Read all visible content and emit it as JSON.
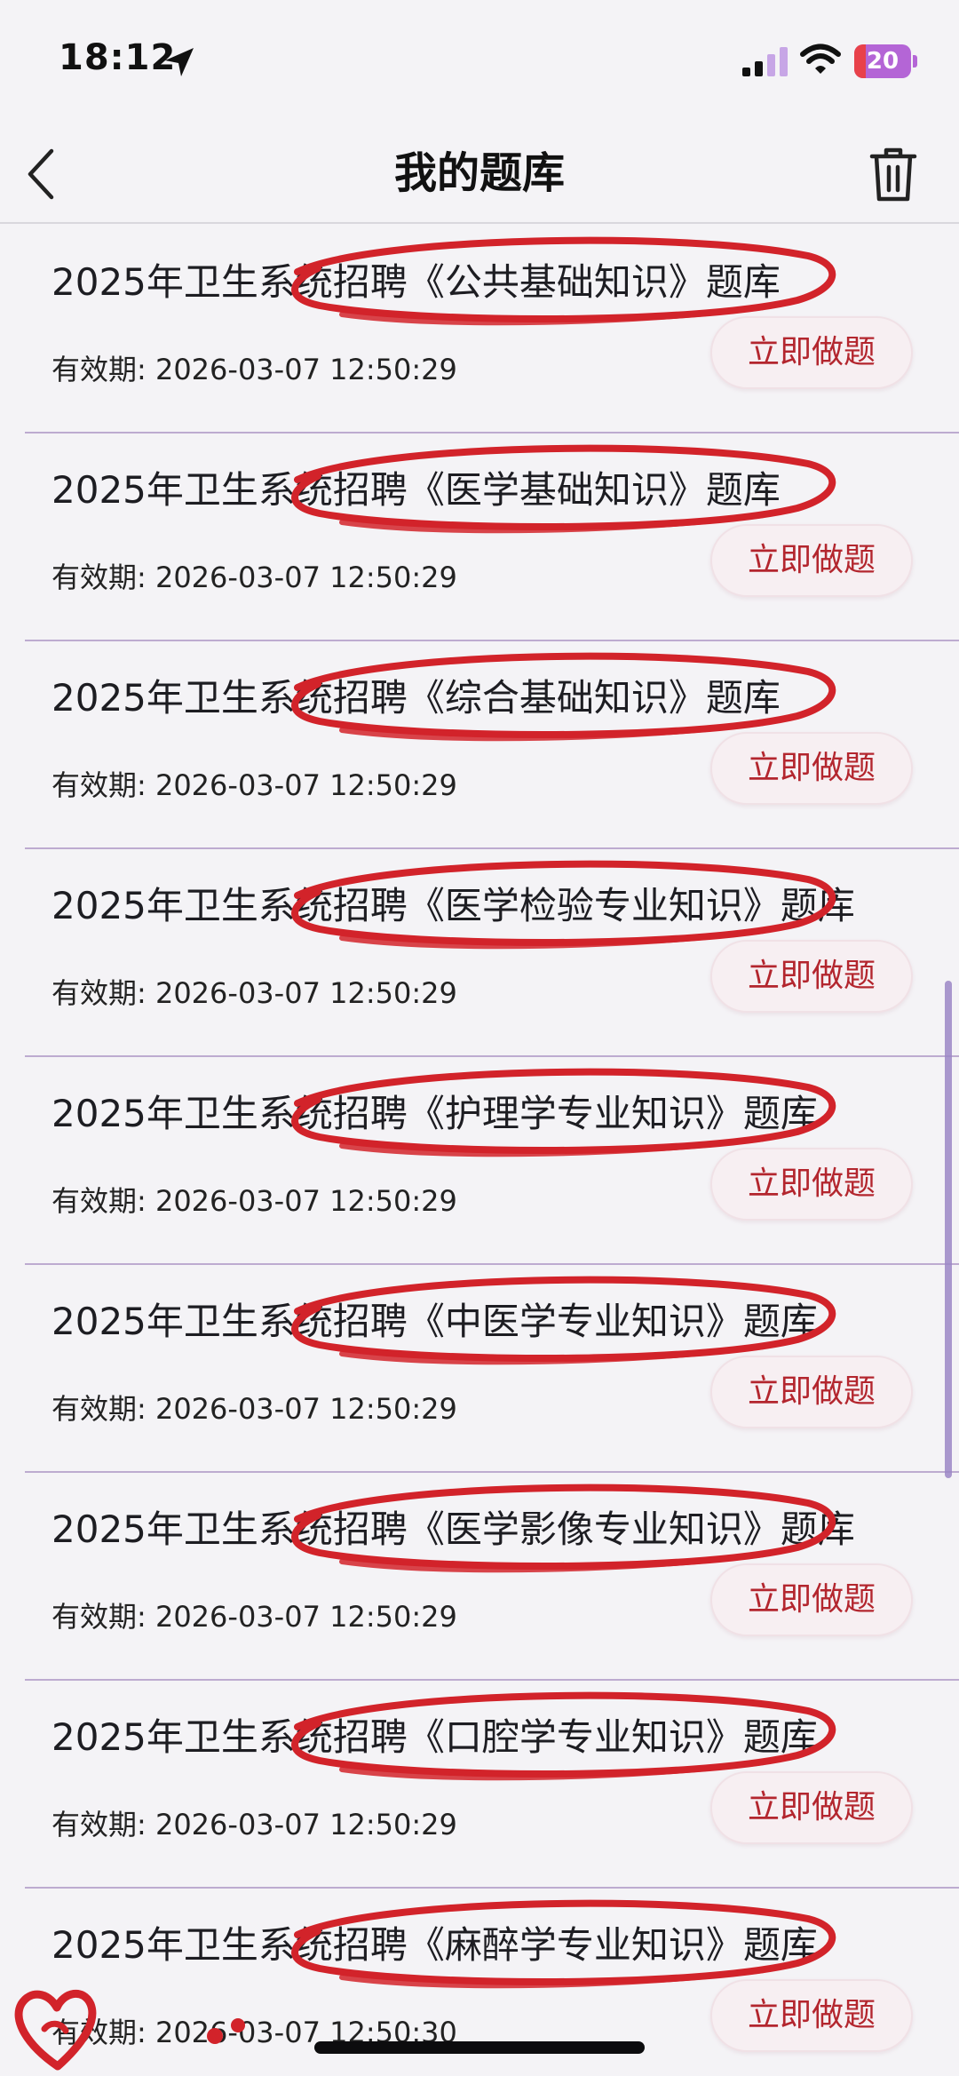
{
  "status_bar": {
    "time": "18:12",
    "battery": "20",
    "battery_level": 0.2,
    "icons": [
      "location-arrow-icon",
      "cellular-signal-icon",
      "wifi-icon",
      "battery-icon"
    ]
  },
  "nav": {
    "title": "我的题库",
    "back_icon": "chevron-left-icon",
    "delete_icon": "trash-icon"
  },
  "colors": {
    "accent": "#b3262e",
    "annotation": "#d2232a",
    "divider": "#8f6fb0",
    "background": "#f4f3f6"
  },
  "items": [
    {
      "title": "2025年卫生系统招聘《公共基础知识》题库",
      "expiry": "有效期: 2026-03-07 12:50:29",
      "action": "立即做题"
    },
    {
      "title": "2025年卫生系统招聘《医学基础知识》题库",
      "expiry": "有效期: 2026-03-07 12:50:29",
      "action": "立即做题"
    },
    {
      "title": "2025年卫生系统招聘《综合基础知识》题库",
      "expiry": "有效期: 2026-03-07 12:50:29",
      "action": "立即做题"
    },
    {
      "title": "2025年卫生系统招聘《医学检验专业知识》题库",
      "expiry": "有效期: 2026-03-07 12:50:29",
      "action": "立即做题"
    },
    {
      "title": "2025年卫生系统招聘《护理学专业知识》题库",
      "expiry": "有效期: 2026-03-07 12:50:29",
      "action": "立即做题"
    },
    {
      "title": "2025年卫生系统招聘《中医学专业知识》题库",
      "expiry": "有效期: 2026-03-07 12:50:29",
      "action": "立即做题"
    },
    {
      "title": "2025年卫生系统招聘《医学影像专业知识》题库",
      "expiry": "有效期: 2026-03-07 12:50:29",
      "action": "立即做题"
    },
    {
      "title": "2025年卫生系统招聘《口腔学专业知识》题库",
      "expiry": "有效期: 2026-03-07 12:50:29",
      "action": "立即做题"
    },
    {
      "title": "2025年卫生系统招聘《麻醉学专业知识》题库",
      "expiry": "有效期: 2026-03-07 12:50:30",
      "action": "立即做题"
    }
  ]
}
